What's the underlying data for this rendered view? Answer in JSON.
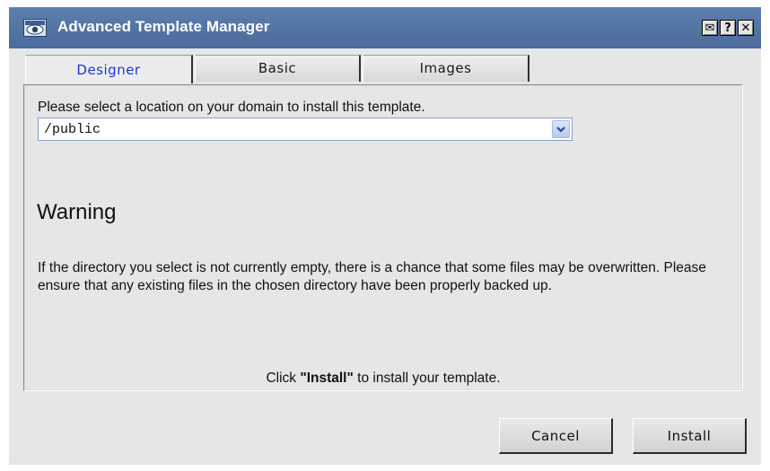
{
  "window": {
    "title": "Advanced Template Manager",
    "title_buttons": [
      {
        "name": "envelope",
        "glyph": "✉"
      },
      {
        "name": "help",
        "glyph": "?"
      },
      {
        "name": "close",
        "glyph": "✕"
      }
    ]
  },
  "tabs": [
    {
      "label": "Designer",
      "active": true
    },
    {
      "label": "Basic",
      "active": false
    },
    {
      "label": "Images",
      "active": false
    }
  ],
  "location": {
    "prompt": "Please select a location on your domain to install this template.",
    "selected_value": "/public"
  },
  "warning": {
    "heading": "Warning",
    "body": "If the directory you select is not currently empty, there is a chance that some files may be overwritten. Please ensure that any existing files in the chosen directory have been properly backed up."
  },
  "instruction": {
    "prefix": "Click ",
    "emphasis": "\"Install\"",
    "suffix": " to install your template."
  },
  "buttons": {
    "cancel": "Cancel",
    "install": "Install"
  },
  "colors": {
    "titlebar": "#5477a8",
    "active_tab_text": "#1f36d6",
    "panel_background": "#e6e6e6"
  }
}
